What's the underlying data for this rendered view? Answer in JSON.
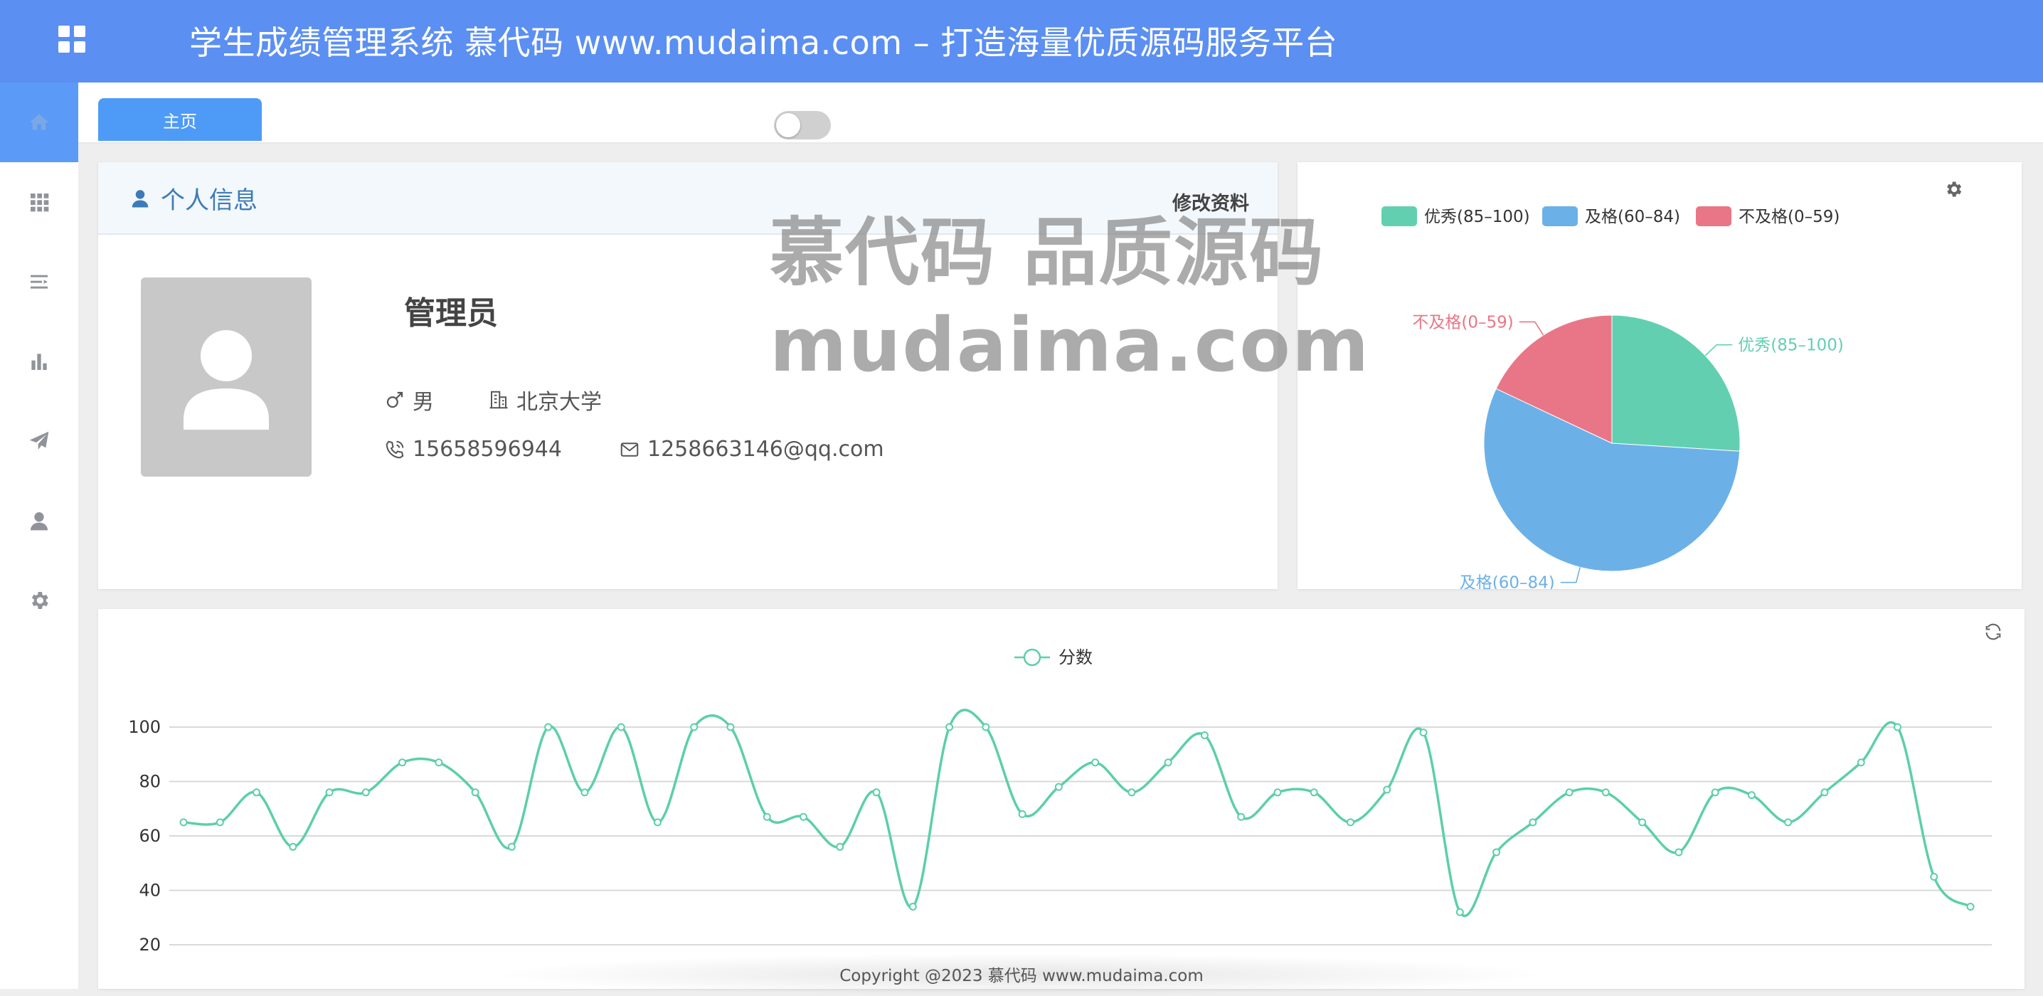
{
  "header": {
    "title": "学生成绩管理系统 慕代码 www.mudaima.com – 打造海量优质源码服务平台"
  },
  "sidebar": {
    "items": [
      {
        "name": "home",
        "icon": "home-icon"
      },
      {
        "name": "dashboard",
        "icon": "grid-icon"
      },
      {
        "name": "list",
        "icon": "list-icon"
      },
      {
        "name": "stats",
        "icon": "bar-chart-icon"
      },
      {
        "name": "send",
        "icon": "paper-plane-icon"
      },
      {
        "name": "user",
        "icon": "user-icon"
      },
      {
        "name": "settings",
        "icon": "gear-icon"
      }
    ]
  },
  "tabs": {
    "home_label": "主页"
  },
  "profile": {
    "title": "个人信息",
    "edit_label": "修改资料",
    "name": "管理员",
    "gender": "男",
    "school": "北京大学",
    "phone": "15658596944",
    "email": "1258663146@qq.com"
  },
  "watermark": {
    "line1": "慕代码 品质源码",
    "line2": "mudaima.com"
  },
  "chart_data": [
    {
      "type": "pie",
      "title": "",
      "legend_position": "top",
      "labels": [
        "优秀(85–100)",
        "及格(60–84)",
        "不及格(0–59)"
      ],
      "values": [
        26,
        56,
        18
      ],
      "colors": [
        "#62d0b0",
        "#6cb0e8",
        "#e97686"
      ]
    },
    {
      "type": "line",
      "series": [
        {
          "name": "分数",
          "color": "#5ccfa8",
          "values": [
            65,
            65,
            76,
            56,
            76,
            76,
            87,
            87,
            76,
            56,
            100,
            76,
            100,
            65,
            100,
            100,
            67,
            67,
            56,
            76,
            34,
            100,
            100,
            68,
            78,
            87,
            76,
            87,
            97,
            67,
            76,
            76,
            65,
            77,
            98,
            32,
            54,
            65,
            76,
            76,
            65,
            54,
            76,
            75,
            65,
            76,
            87,
            100,
            45,
            34
          ]
        }
      ],
      "ylim": [
        20,
        100
      ],
      "yticks": [
        100,
        80,
        60,
        40,
        20
      ],
      "grid": true,
      "legend_position": "top"
    }
  ],
  "footer": {
    "copyright": "Copyright @2023 慕代码 www.mudaima.com"
  }
}
